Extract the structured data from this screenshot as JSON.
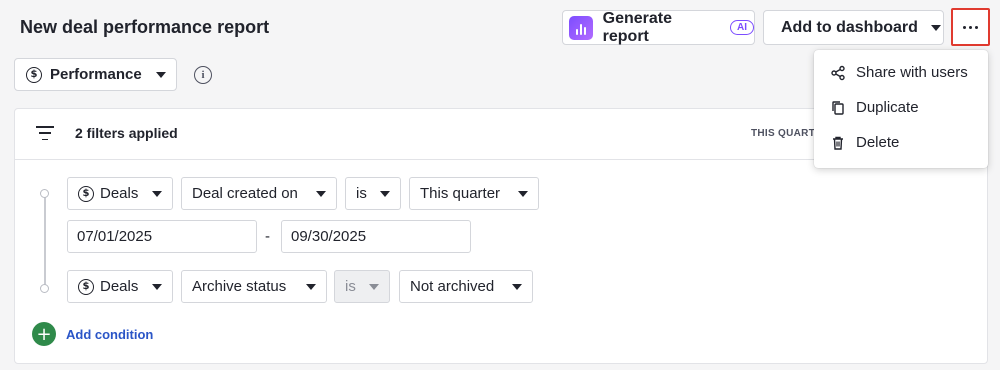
{
  "header": {
    "title": "New deal performance report",
    "generate_label": "Generate report",
    "ai_badge": "AI",
    "dashboard_label": "Add to dashboard"
  },
  "view_select": {
    "label": "Performance",
    "currency_icon": "$"
  },
  "filters": {
    "summary": "2 filters applied",
    "period_label": "THIS QUARTER",
    "conditions": [
      {
        "entity": "Deals",
        "field": "Deal created on",
        "operator": "is",
        "value": "This quarter",
        "range_from": "07/01/2025",
        "range_separator": "-",
        "range_to": "09/30/2025"
      },
      {
        "entity": "Deals",
        "field": "Archive status",
        "operator": "is",
        "value": "Not archived"
      }
    ],
    "add_condition": "Add condition"
  },
  "more_menu": {
    "items": [
      {
        "label": "Share with users",
        "icon": "share-icon"
      },
      {
        "label": "Duplicate",
        "icon": "duplicate-icon"
      },
      {
        "label": "Delete",
        "icon": "trash-icon"
      }
    ]
  },
  "colors": {
    "ai_purple": "#7c4dff",
    "add_green": "#2f8a4a",
    "link_blue": "#2a55c7",
    "highlight_red": "#e03a2f"
  }
}
